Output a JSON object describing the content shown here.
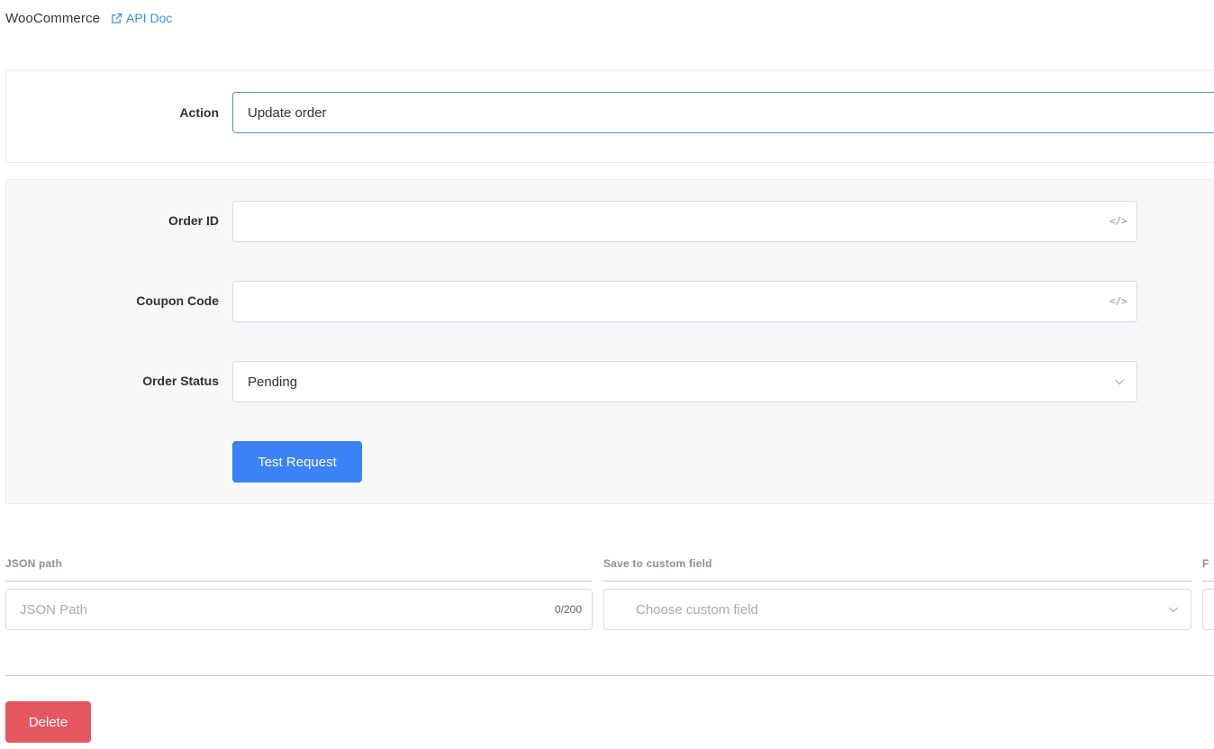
{
  "header": {
    "title": "WooCommerce",
    "api_doc_label": "API Doc"
  },
  "action": {
    "label": "Action",
    "value": "Update order"
  },
  "params": {
    "order_id": {
      "label": "Order ID",
      "value": "",
      "icon": "code-icon"
    },
    "coupon_code": {
      "label": "Coupon Code",
      "value": "",
      "icon": "code-icon"
    },
    "order_status": {
      "label": "Order Status",
      "value": "Pending"
    },
    "test_button_label": "Test Request"
  },
  "mapping": {
    "columns": {
      "json_path": "JSON path",
      "custom_field": "Save to custom field",
      "third_truncated": "F"
    },
    "json_path_placeholder": "JSON Path",
    "json_path_counter": "0/200",
    "custom_field_placeholder": "Choose custom field"
  },
  "delete_label": "Delete",
  "colors": {
    "primary": "#3b82f6",
    "danger": "#e4575f",
    "link": "#3a8ee6",
    "focus_border": "#4a8fe0"
  }
}
